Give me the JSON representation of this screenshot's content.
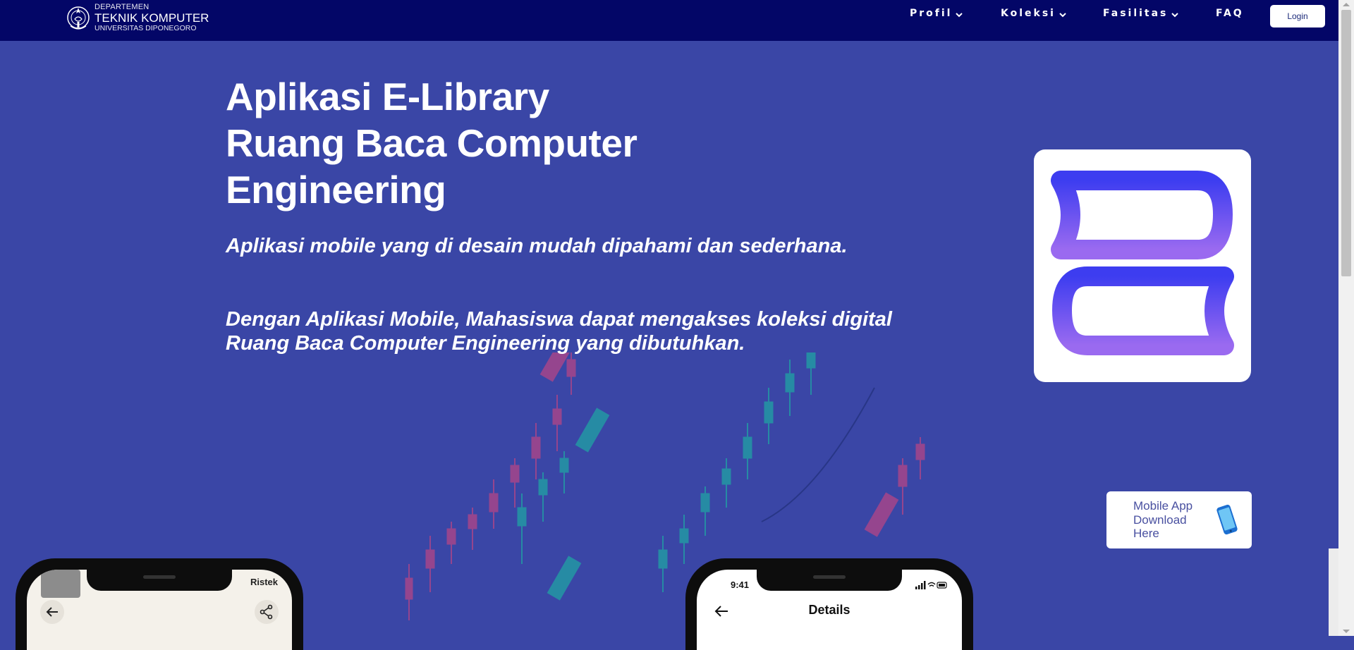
{
  "navbar": {
    "logo": {
      "line1": "DEPARTEMEN",
      "line2": "TEKNIK KOMPUTER",
      "line3": "UNIVERSITAS DIPONEGORO"
    },
    "items": [
      {
        "label": "Profil",
        "has_dropdown": true
      },
      {
        "label": "Koleksi",
        "has_dropdown": true
      },
      {
        "label": "Fasilitas",
        "has_dropdown": true
      },
      {
        "label": "FAQ",
        "has_dropdown": false
      }
    ],
    "login_label": "Login"
  },
  "hero": {
    "title_lines": [
      "Aplikasi E-Library",
      "Ruang Baca Computer",
      "Engineering"
    ],
    "description_1": "Aplikasi mobile yang di desain mudah dipahami dan sederhana.",
    "description_2": "Dengan Aplikasi Mobile, Mahasiswa dapat mengakses koleksi digital Ruang Baca Computer Engineering yang dibutuhkan."
  },
  "download_card": {
    "label": "Mobile App Download Here",
    "icon": "smartphone-icon"
  },
  "app_icon": {
    "icon": "e-library-logo-icon",
    "gradient_top": "#3d3df0",
    "gradient_bottom": "#9a6af0"
  },
  "phones": {
    "left": {
      "status_text": "Ristek",
      "icons": [
        "back-arrow-icon",
        "share-icon"
      ]
    },
    "right": {
      "time": "9:41",
      "title": "Details",
      "icons": [
        "back-arrow-icon"
      ]
    }
  },
  "colors": {
    "navbar": "#030667",
    "background": "#3a46a6",
    "accent_pink": "#e0457b",
    "accent_teal": "#17c4a4"
  }
}
